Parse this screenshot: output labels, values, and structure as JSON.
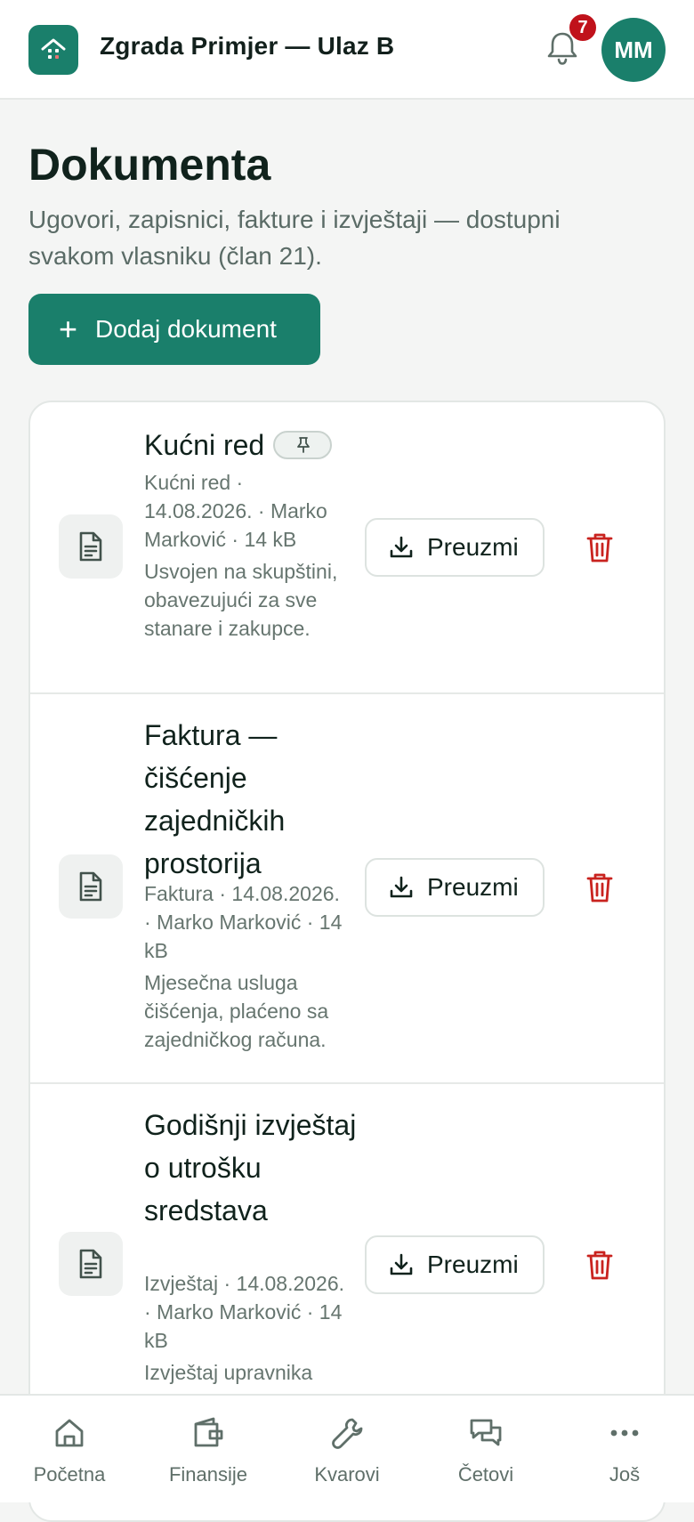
{
  "header": {
    "title": "Zgrada Primjer — Ulaz B",
    "notification_count": "7",
    "avatar_initials": "MM",
    "accent_color": "#1a7f6b",
    "badge_color": "#c0121b"
  },
  "page": {
    "title": "Dokumenta",
    "subtitle": "Ugovori, zapisnici, fakture i izvještaji — dostupni svakom vlasniku (član 21).",
    "add_button_label": "Dodaj dokument"
  },
  "documents": [
    {
      "title": "Kućni red",
      "pinned": true,
      "meta": "Kućni red · 14.08.2026. · Marko Marković · 14 kB",
      "description": "Usvojen na skupštini, obavezujući za sve stanare i zakupce.",
      "download_label": "Preuzmi"
    },
    {
      "title": "Faktura — čišćenje zajedničkih prostorija",
      "pinned": false,
      "meta": "Faktura · 14.08.2026. · Marko Marković · 14 kB",
      "description": "Mjesečna usluga čišćenja, plaćeno sa zajedničkog računa.",
      "download_label": "Preuzmi"
    },
    {
      "title": "Godišnji izvještaj o utrošku sredstava",
      "pinned": false,
      "meta": "Izvještaj · 14.08.2026. · Marko Marković · 14 kB",
      "description": "Izvještaj upravnika",
      "download_label": "Preuzmi"
    }
  ],
  "bottom_nav": [
    {
      "label": "Početna",
      "icon": "home-icon"
    },
    {
      "label": "Finansije",
      "icon": "wallet-icon"
    },
    {
      "label": "Kvarovi",
      "icon": "wrench-icon"
    },
    {
      "label": "Četovi",
      "icon": "chat-icon"
    },
    {
      "label": "Još",
      "icon": "more-icon"
    }
  ]
}
